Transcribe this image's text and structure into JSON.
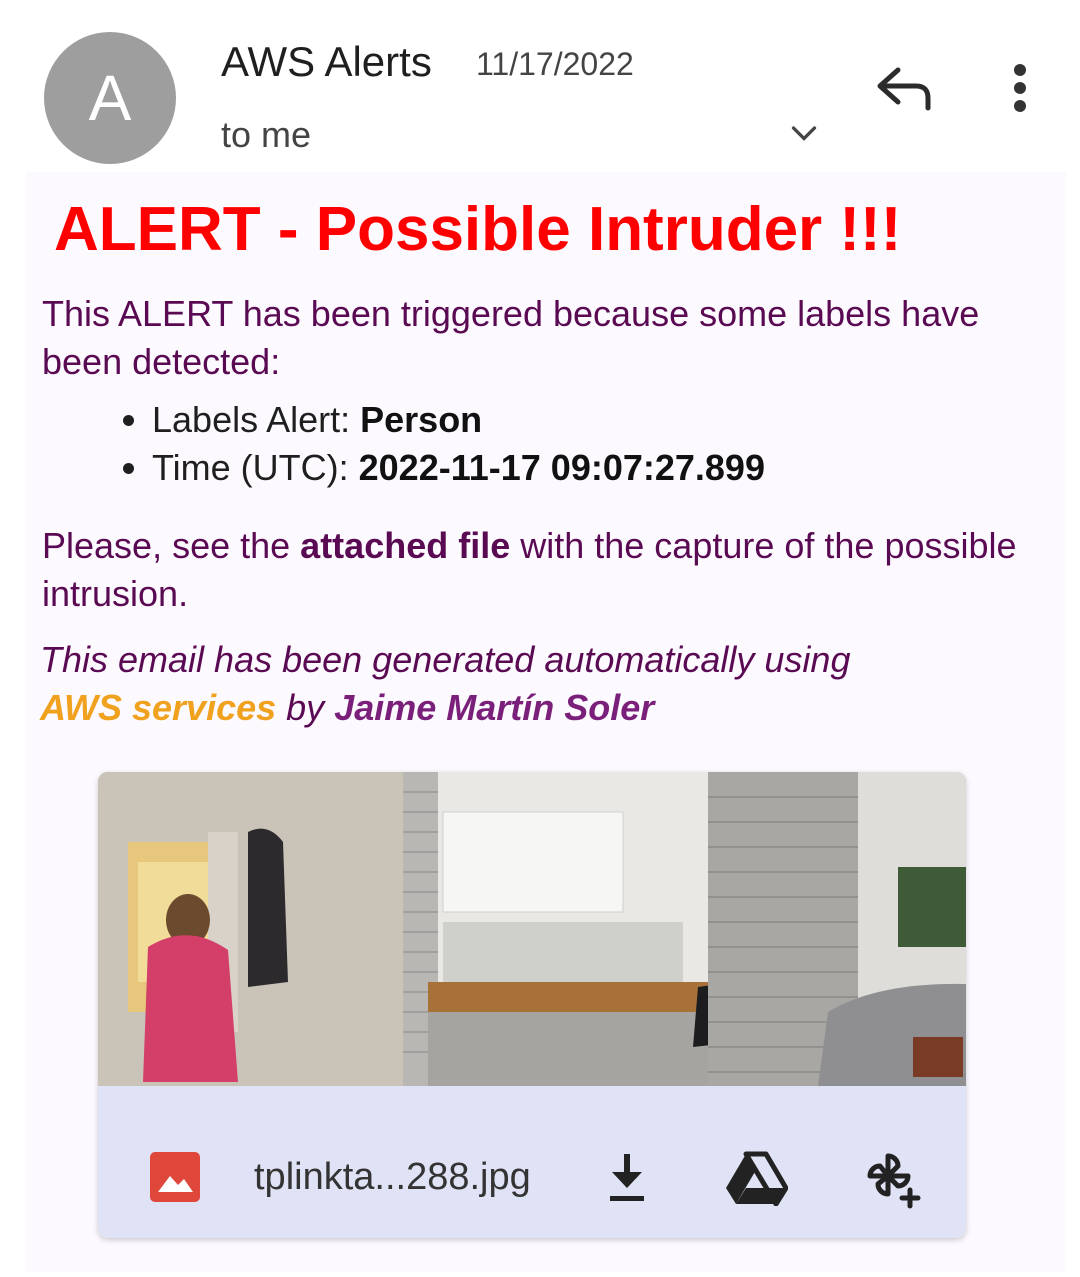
{
  "header": {
    "avatar_letter": "A",
    "sender": "AWS Alerts",
    "date": "11/17/2022",
    "recipient": "to me",
    "icons": [
      "chevron-down-icon",
      "reply-icon",
      "more-vert-icon"
    ]
  },
  "email": {
    "title": "ALERT - Possible Intruder !!!",
    "intro": "This ALERT has been triggered because some labels have been detected:",
    "bullets": [
      {
        "label": "Labels Alert: ",
        "value": "Person"
      },
      {
        "label": "Time (UTC): ",
        "value": "2022-11-17 09:07:27.899"
      }
    ],
    "please_before": "Please, see the ",
    "please_bold": "attached file",
    "please_after": " with the capture of the possible intrusion.",
    "footer_line1": "This email has been generated automatically using",
    "footer_link": "AWS services",
    "footer_by": " by ",
    "footer_author": "Jaime Martín Soler",
    "colors": {
      "title": "#ff0000",
      "body_text": "#5a0a52",
      "link": "#f0a21e",
      "author": "#7a1f7a"
    }
  },
  "attachment": {
    "filename": "tplinkta...288.jpg",
    "icons": [
      "image-file-icon",
      "download-icon",
      "drive-icon",
      "add-to-photos-icon"
    ]
  }
}
